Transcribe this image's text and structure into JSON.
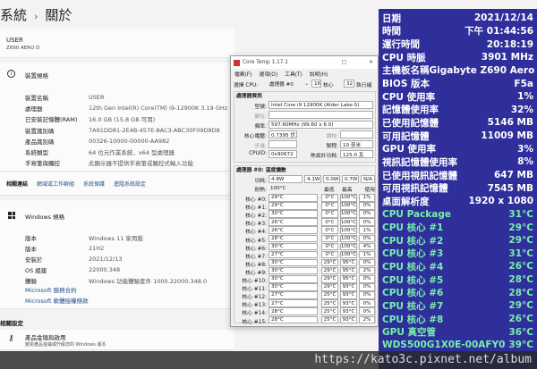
{
  "settings": {
    "crumb": "系統",
    "title": "關於",
    "device": "USER",
    "model": "Z690 AERO D",
    "device_spec_title": "裝置規格",
    "device_spec": [
      [
        "裝置名稱",
        "USER"
      ],
      [
        "處理器",
        "12th Gen Intel(R) Core(TM) i9-12900K   3.19 GHz"
      ],
      [
        "已安裝記憶體(RAM)",
        "16.0 GB (15.8 GB 可用)"
      ],
      [
        "裝置識別碼",
        "7A91DD81-2E4B-457E-8AC3-ABC30F09D8D8"
      ],
      [
        "產品識別碼",
        "00326-10000-00000-AA982"
      ],
      [
        "系統類型",
        "64 位元作業系統，x64 型處理器"
      ],
      [
        "手寫筆與觸控",
        "此顯示器不提供手寫筆或觸控式輸入功能"
      ]
    ],
    "related_label": "相關連結",
    "related_links": [
      "網域或工作群組",
      "系統保護",
      "進階系統設定"
    ],
    "windows_spec_title": "Windows 規格",
    "windows_spec": [
      [
        "版本",
        "Windows 11 家用版"
      ],
      [
        "版本",
        "21H2"
      ],
      [
        "安裝於",
        "2021/12/13"
      ],
      [
        "OS 組建",
        "22000.348"
      ],
      [
        "體驗",
        "Windows 功能體驗套件 1000.22000.348.0"
      ]
    ],
    "ms_links": [
      "Microsoft 服務合約",
      "Microsoft 軟體授權條款"
    ],
    "related_settings": "相關設定",
    "product_key": "產品金鑰與啟用",
    "product_key_sub": "變更產品金鑰或升級您的 Windows 版本"
  },
  "coretemp": {
    "title": "Core Temp 1.17.1",
    "menu": [
      "檔案(F)",
      "選項(O)",
      "工具(T)",
      "說明(H)"
    ],
    "select_label": "選擇 CPU:",
    "select_value": "處理器 #0",
    "cores": "16",
    "cores_label": "核心",
    "threads": "32",
    "threads_label": "執行緒",
    "info_title": "處理器資訊",
    "model_label": "型號:",
    "model": "Intel Core i9 12900K (Alder Lake-S)",
    "platform_label": "腳位:",
    "freq_label": "頻率:",
    "freq": "597.60MHz (99.60 x 6.0)",
    "vid_label": "核心電壓:",
    "vid": "0.7395 伏",
    "mod_label": "調校:",
    "rev_label": "步進:",
    "lith_label": "製程:",
    "lith": "10 奈米",
    "cpuid_label": "CPUID:",
    "cpuid": "0x90672",
    "tdp_label": "熱設計功耗:",
    "tdp": "125.0 瓦",
    "temp_title": "處理器 #0: 溫度讀數",
    "power_label": "功耗:",
    "power": [
      "4.8W",
      "4.1W",
      "0.0W",
      "0.7W",
      "N/A"
    ],
    "tjmax_label": "耐熱:",
    "tjmax": "100°C",
    "min_h": "最低",
    "max_h": "最高",
    "load_h": "使用率",
    "cores_rows": [
      [
        "核心 #0:",
        "29°C",
        "0°C",
        "100°C",
        "1%"
      ],
      [
        "核心 #1:",
        "29°C",
        "0°C",
        "100°C",
        "0%"
      ],
      [
        "核心 #2:",
        "30°C",
        "0°C",
        "100°C",
        "0%"
      ],
      [
        "核心 #3:",
        "26°C",
        "0°C",
        "100°C",
        "0%"
      ],
      [
        "核心 #4:",
        "26°C",
        "0°C",
        "100°C",
        "1%"
      ],
      [
        "核心 #5:",
        "28°C",
        "0°C",
        "100°C",
        "0%"
      ],
      [
        "核心 #6:",
        "30°C",
        "0°C",
        "100°C",
        "4%"
      ],
      [
        "核心 #7:",
        "27°C",
        "0°C",
        "100°C",
        "1%"
      ],
      [
        "核心 #8:",
        "30°C",
        "29°C",
        "95°C",
        "0%"
      ],
      [
        "核心 #9:",
        "30°C",
        "29°C",
        "95°C",
        "2%"
      ],
      [
        "核心 #10:",
        "30°C",
        "29°C",
        "95°C",
        "0%"
      ],
      [
        "核心 #11:",
        "30°C",
        "29°C",
        "93°C",
        "0%"
      ],
      [
        "核心 #12:",
        "27°C",
        "25°C",
        "93°C",
        "0%"
      ],
      [
        "核心 #13:",
        "27°C",
        "25°C",
        "93°C",
        "0%"
      ],
      [
        "核心 #14:",
        "28°C",
        "25°C",
        "93°C",
        "0%"
      ],
      [
        "核心 #15:",
        "28°C",
        "25°C",
        "93°C",
        "2%"
      ]
    ]
  },
  "monitor": {
    "rows": [
      [
        "日期",
        "2021/12/14"
      ],
      [
        "時間",
        "下午 01:44:56"
      ],
      [
        "運行時間",
        "20:18:19"
      ],
      [
        "CPU 時脈",
        "3901 MHz"
      ],
      [
        "主機板名稱",
        "Gigabyte Z690 Aero D"
      ],
      [
        "BIOS 版本",
        "F5a"
      ],
      [
        "CPU 使用率",
        "1%"
      ],
      [
        "記憶體使用率",
        "32%"
      ],
      [
        "已使用記憶體",
        "5146 MB"
      ],
      [
        "可用記憶體",
        "11009 MB"
      ],
      [
        "GPU 使用率",
        "3%"
      ],
      [
        "視訊記憶體使用率",
        "8%"
      ],
      [
        "已使用視訊記憶體",
        "647 MB"
      ],
      [
        "可用視訊記憶體",
        "7545 MB"
      ],
      [
        "桌面解析度",
        "1920 x 1080"
      ]
    ],
    "temps": [
      [
        "CPU Package",
        "31°C"
      ],
      [
        "CPU 核心 #1",
        "29°C"
      ],
      [
        "CPU 核心 #2",
        "29°C"
      ],
      [
        "CPU 核心 #3",
        "31°C"
      ],
      [
        "CPU 核心 #4",
        "26°C"
      ],
      [
        "CPU 核心 #5",
        "28°C"
      ],
      [
        "CPU 核心 #6",
        "28°C"
      ],
      [
        "CPU 核心 #7",
        "29°C"
      ],
      [
        "CPU 核心 #8",
        "26°C"
      ],
      [
        "GPU 真空管",
        "36°C"
      ],
      [
        "WDS500G1X0E-00AFY0",
        "39°C"
      ]
    ]
  },
  "watermark": "https://kato3c.pixnet.net/album",
  "colors": {
    "monitor_bg": "#2f2f9c",
    "temp_text": "#78f0a8",
    "link": "#1f4f8a"
  }
}
